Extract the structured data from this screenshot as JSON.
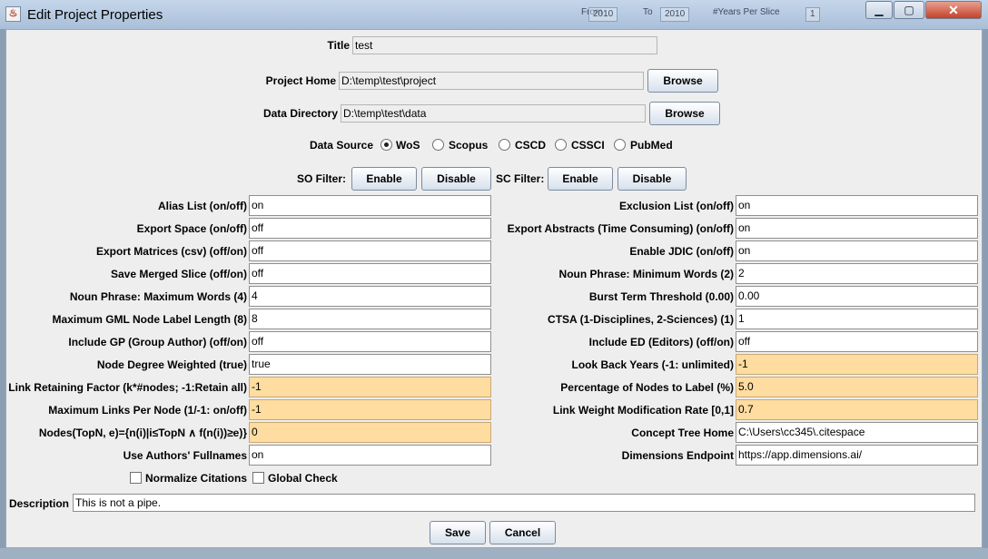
{
  "window": {
    "title": "Edit Project Properties",
    "background_ghost": [
      "From",
      "2010",
      "To",
      "2010",
      "#Years Per Slice",
      "1"
    ]
  },
  "title_field": {
    "label": "Title",
    "value": "test"
  },
  "project_home": {
    "label": "Project Home",
    "value": "D:\\temp\\test\\project",
    "button": "Browse"
  },
  "data_directory": {
    "label": "Data Directory",
    "value": "D:\\temp\\test\\data",
    "button": "Browse"
  },
  "data_source": {
    "label": "Data Source",
    "options": [
      "WoS",
      "Scopus",
      "CSCD",
      "CSSCI",
      "PubMed"
    ],
    "selected": "WoS"
  },
  "so_filter": {
    "label": "SO Filter:",
    "enable": "Enable",
    "disable": "Disable"
  },
  "sc_filter": {
    "label": "SC Filter:",
    "enable": "Enable",
    "disable": "Disable"
  },
  "left_params": [
    {
      "label": "Alias List (on/off)",
      "value": "on",
      "highlight": false
    },
    {
      "label": "Export Space (on/off)",
      "value": "off",
      "highlight": false
    },
    {
      "label": "Export Matrices (csv) (off/on)",
      "value": "off",
      "highlight": false
    },
    {
      "label": "Save Merged Slice (off/on)",
      "value": "off",
      "highlight": false
    },
    {
      "label": "Noun Phrase: Maximum Words (4)",
      "value": "4",
      "highlight": false
    },
    {
      "label": "Maximum GML Node Label Length (8)",
      "value": "8",
      "highlight": false
    },
    {
      "label": "Include GP (Group Author) (off/on)",
      "value": "off",
      "highlight": false
    },
    {
      "label": "Node Degree Weighted (true)",
      "value": "true",
      "highlight": false
    },
    {
      "label": "Link Retaining Factor (k*#nodes; -1:Retain all)",
      "value": "-1",
      "highlight": true
    },
    {
      "label": "Maximum Links Per Node (1/-1: on/off)",
      "value": "-1",
      "highlight": true
    },
    {
      "label": "Nodes(TopN, e)={n(i)|i≤TopN ∧ f(n(i))≥e)}",
      "value": "0",
      "highlight": true
    },
    {
      "label": "Use Authors' Fullnames",
      "value": "on",
      "highlight": false
    }
  ],
  "right_params": [
    {
      "label": "Exclusion List (on/off)",
      "value": "on",
      "highlight": false
    },
    {
      "label": "Export Abstracts (Time Consuming) (on/off)",
      "value": "on",
      "highlight": false
    },
    {
      "label": "Enable JDIC (on/off)",
      "value": "on",
      "highlight": false
    },
    {
      "label": "Noun Phrase: Minimum Words (2)",
      "value": "2",
      "highlight": false
    },
    {
      "label": "Burst Term Threshold (0.00)",
      "value": "0.00",
      "highlight": false
    },
    {
      "label": "CTSA (1-Disciplines, 2-Sciences) (1)",
      "value": "1",
      "highlight": false
    },
    {
      "label": "Include ED (Editors) (off/on)",
      "value": "off",
      "highlight": false
    },
    {
      "label": "Look Back Years (-1: unlimited)",
      "value": "-1",
      "highlight": true
    },
    {
      "label": "Percentage of Nodes to Label (%)",
      "value": "5.0",
      "highlight": true
    },
    {
      "label": "Link Weight Modification Rate [0,1]",
      "value": "0.7",
      "highlight": true
    },
    {
      "label": "Concept Tree Home",
      "value": "C:\\Users\\cc345\\.citespace",
      "highlight": false
    },
    {
      "label": "Dimensions Endpoint",
      "value": "https://app.dimensions.ai/",
      "highlight": false
    }
  ],
  "checkboxes": [
    {
      "label": "Normalize Citations",
      "checked": false
    },
    {
      "label": "Global Check",
      "checked": false
    }
  ],
  "description": {
    "label": "Description",
    "value": "This is not a pipe."
  },
  "actions": {
    "save": "Save",
    "cancel": "Cancel"
  },
  "colors": {
    "highlight_field": "#ffdca0",
    "panel": "#eeeeee",
    "titlebar": "#b8cbe2"
  }
}
